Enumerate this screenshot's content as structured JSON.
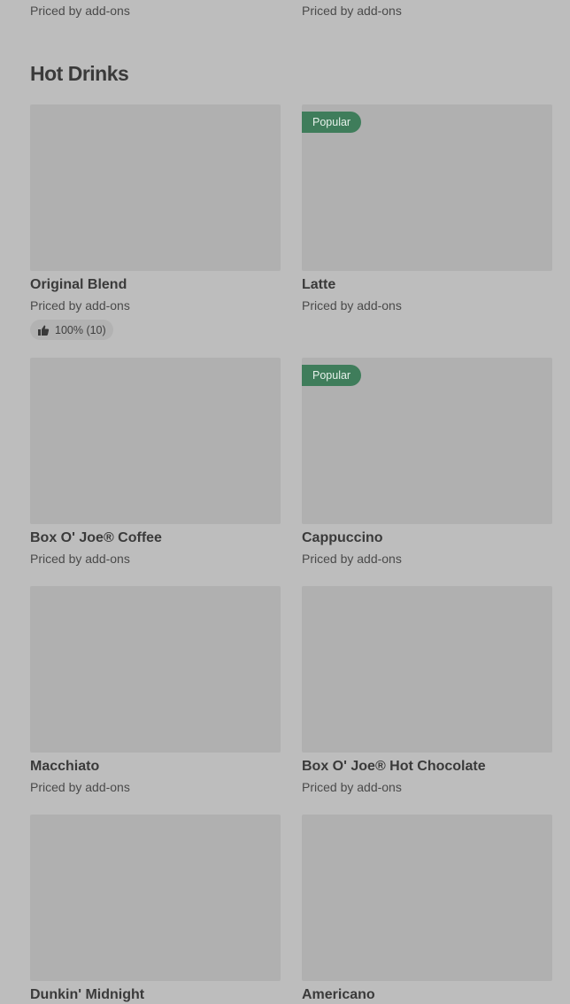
{
  "top_row": {
    "left_price": "Priced by add-ons",
    "right_price": "Priced by add-ons"
  },
  "section": {
    "title": "Hot Drinks"
  },
  "items": [
    {
      "name": "Original Blend",
      "price": "Priced by add-ons",
      "rating": "100% (10)"
    },
    {
      "name": "Latte",
      "price": "Priced by add-ons",
      "badge": "Popular"
    },
    {
      "name": "Box O' Joe® Coffee",
      "price": "Priced by add-ons"
    },
    {
      "name": "Cappuccino",
      "price": "Priced by add-ons",
      "badge": "Popular"
    },
    {
      "name": "Macchiato",
      "price": "Priced by add-ons"
    },
    {
      "name": "Box O' Joe® Hot Chocolate",
      "price": "Priced by add-ons"
    },
    {
      "name": "Dunkin' Midnight"
    },
    {
      "name": "Americano"
    }
  ],
  "colors": {
    "page_bg": "#bdbdbd",
    "placeholder_bg": "#b0b0b0",
    "badge_bg": "#3f7d5b"
  },
  "icons": {
    "rating": "thumbs-up-icon"
  }
}
